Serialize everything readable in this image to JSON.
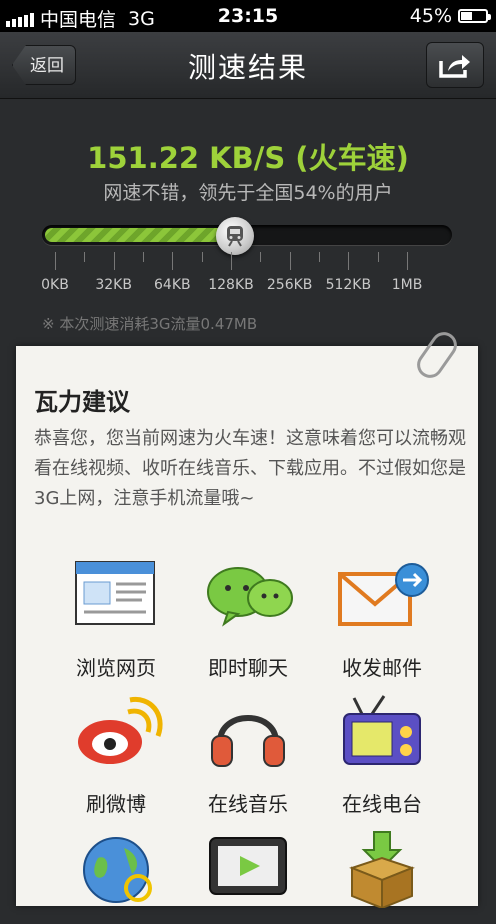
{
  "status_bar": {
    "carrier": "中国电信",
    "network": "3G",
    "time": "23:15",
    "battery_percent": "45%",
    "battery_level": 0.45
  },
  "nav": {
    "back_label": "返回",
    "title": "测速结果"
  },
  "result": {
    "speed_text": "151.22 KB/S (火车速)",
    "description": "网速不错，领先于全国54%的用户",
    "speed_position": 0.47,
    "scale_labels": [
      "0KB",
      "32KB",
      "64KB",
      "128KB",
      "256KB",
      "512KB",
      "1MB"
    ],
    "usage_note": "※ 本次测速消耗3G流量0.47MB",
    "accent_color": "#9ed23a"
  },
  "advice": {
    "title": "瓦力建议",
    "body": "恭喜您，您当前网速为火车速！这意味着您可以流畅观看在线视频、收听在线音乐、下载应用。不过假如您是3G上网，注意手机流量哦~"
  },
  "features": [
    {
      "label": "浏览网页",
      "icon": "browser-icon"
    },
    {
      "label": "即时聊天",
      "icon": "chat-icon"
    },
    {
      "label": "收发邮件",
      "icon": "mail-icon"
    },
    {
      "label": "刷微博",
      "icon": "weibo-icon"
    },
    {
      "label": "在线音乐",
      "icon": "headphones-icon"
    },
    {
      "label": "在线电台",
      "icon": "radio-icon"
    },
    {
      "label": "",
      "icon": "globe-icon"
    },
    {
      "label": "",
      "icon": "video-icon"
    },
    {
      "label": "",
      "icon": "download-box-icon"
    }
  ]
}
